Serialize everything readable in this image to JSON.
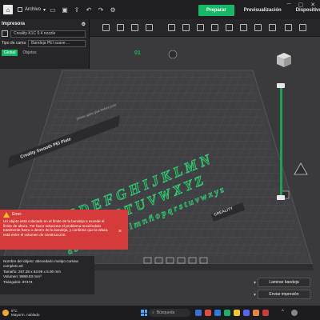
{
  "titlebar": {
    "file_label": "Archivo",
    "tabs": [
      {
        "label": "Preparar",
        "active": true
      },
      {
        "label": "Previsualización",
        "active": false
      },
      {
        "label": "Dispositivo",
        "active": false
      }
    ],
    "accent": "#17b865"
  },
  "left_panel": {
    "title": "Impresora",
    "printer": "Creality K1C 0.4 nozzle",
    "plate_type_label": "Tipo de cama",
    "plate_type_value": "Bandeja PEI suave ...",
    "tab_global": "Global",
    "tab_objects": "Objetos"
  },
  "scene": {
    "plate_number": "01",
    "plate_name": "Creality Smooth PEI Plate",
    "plate_hint": "please apply glue before print",
    "brand": "CREALITY",
    "model_lines": [
      "A B C D E F G H I J K L M N",
      "Ñ O P Q R S T U V W X Y Z",
      "a b c d e f g h i j k l m n ñ o p q r s t u v w x y z"
    ]
  },
  "error": {
    "title": "Error:",
    "message": "Un objeto está colocado en el límite de la bandeja o excede el límite de altura. Por favor solucione el problema moviéndolo totalmente fuera o dentro de la bandeja, y confirme que la altura está entre el volumen de construcción.",
    "color": "#d63b3b"
  },
  "object_info": {
    "name": "Nombre del objeto: abecedario motipo cursiva completo.stl",
    "size": "Tamaño: 267.38 x 63.98 x 5.00 mm",
    "volume": "Volumen: 9969.93 mm³",
    "triangles": "Triángulos: 97474"
  },
  "actions": {
    "slice": "Laminar bandeja",
    "print": "Enviar impresión"
  },
  "taskbar": {
    "temp": "9°C",
    "weather": "Mayorm. nublado",
    "search": "Búsqueda"
  }
}
